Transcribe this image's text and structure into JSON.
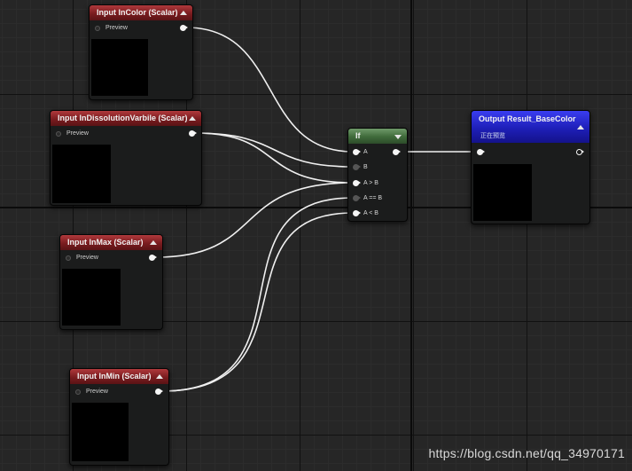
{
  "nodes": {
    "incolor": {
      "title": "Input InColor (Scalar)",
      "preview": "Preview"
    },
    "indissolution": {
      "title": "Input InDissolutionVarbile (Scalar)",
      "preview": "Preview"
    },
    "inmax": {
      "title": "Input InMax (Scalar)",
      "preview": "Preview"
    },
    "inmin": {
      "title": "Input InMin (Scalar)",
      "preview": "Preview"
    },
    "if_node": {
      "title": "If",
      "inputs": [
        "A",
        "B",
        "A > B",
        "A == B",
        "A < B"
      ]
    },
    "output": {
      "title": "Output Result_BaseColor",
      "subtitle": "正在预览"
    }
  },
  "watermark": "https://blog.csdn.net/qq_34970171",
  "colors": {
    "scalar_header": "#7a1c1f",
    "if_header": "#3f6a3a",
    "output_header": "#1e1fb8",
    "wire": "#f0f0f0",
    "background": "#262626"
  }
}
